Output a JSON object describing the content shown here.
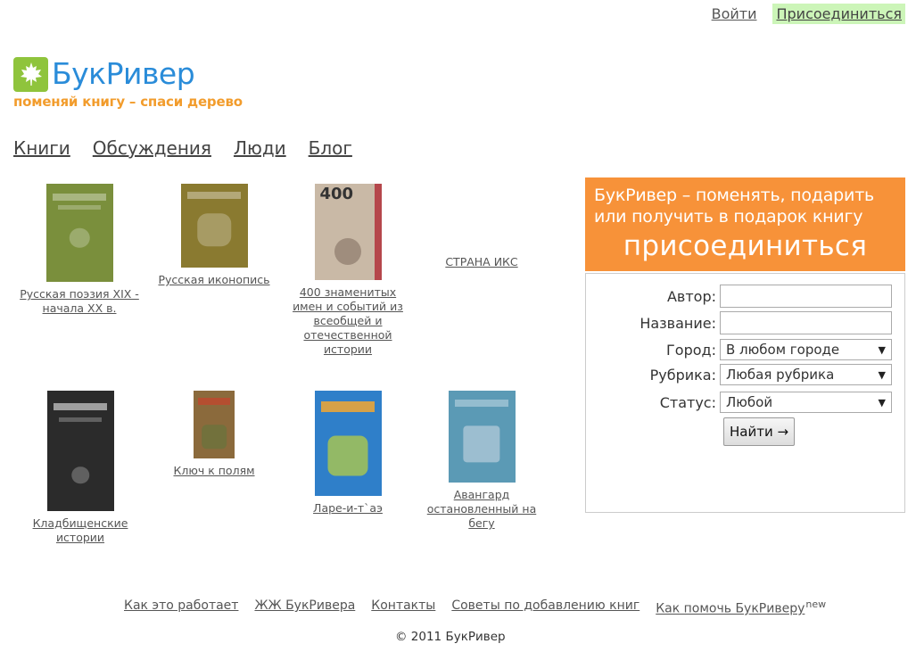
{
  "auth": {
    "login": "Войти",
    "join": "Присоединиться"
  },
  "logo": {
    "name": "БукРивер",
    "tagline": "поменяй книгу – спаси дерево"
  },
  "nav": [
    "Книги",
    "Обсуждения",
    "Люди",
    "Блог"
  ],
  "books": [
    {
      "title": "Русская поэзия XIX - начала XX в.",
      "cover_color": "#7a8f3c"
    },
    {
      "title": "Русская иконопись",
      "cover_color": "#8a7a30"
    },
    {
      "title": "400 знаменитых имен и событий из всеобщей и отечественной истории",
      "cover_color": "#c9b9a6"
    },
    {
      "title": "СТРАНА ИКС",
      "cover_color": ""
    },
    {
      "title": "Кладбищенские истории",
      "cover_color": "#2b2b2b"
    },
    {
      "title": "Ключ к полям",
      "cover_color": "#8b6a3c"
    },
    {
      "title": "Ларе-и-т`аэ",
      "cover_color": "#2f7fc9"
    },
    {
      "title": "Авангард остановленный на бегу",
      "cover_color": "#5b9ab5"
    }
  ],
  "promo": {
    "text": "БукРивер – поменять, подарить или получить в подарок книгу",
    "join": "присоединиться"
  },
  "search": {
    "author_label": "Автор:",
    "title_label": "Название:",
    "city_label": "Город:",
    "city_value": "В любом городе",
    "rubric_label": "Рубрика:",
    "rubric_value": "Любая рубрика",
    "status_label": "Статус:",
    "status_value": "Любой",
    "submit": "Найти →"
  },
  "footer": {
    "links": [
      "Как это работает",
      "ЖЖ БукРивера",
      "Контакты",
      "Советы по добавлению книг",
      "Как помочь БукРиверу"
    ],
    "new_badge": "new",
    "copyright": "© 2011 БукРивер"
  },
  "colors": {
    "brand_blue": "#2a8cd9",
    "brand_orange": "#f79239",
    "leaf_green": "#8fc43c",
    "join_bg": "#ccf5b8"
  }
}
